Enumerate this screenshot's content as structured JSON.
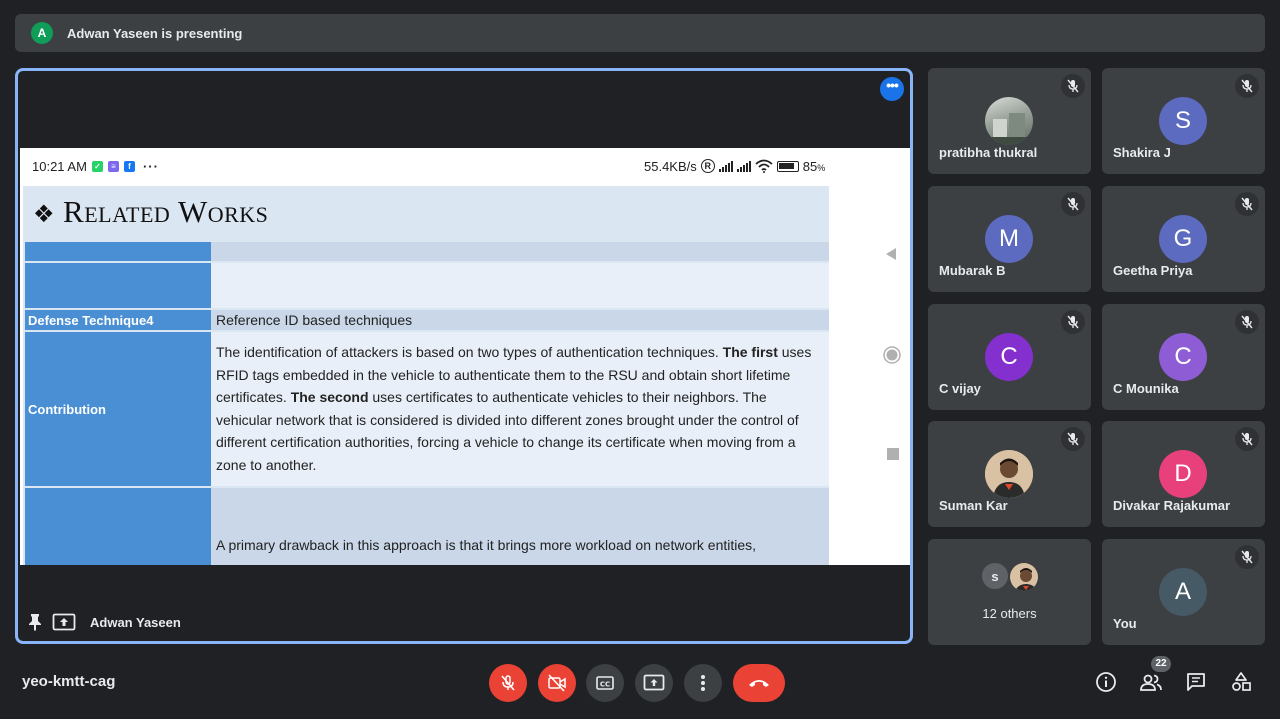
{
  "presenting": {
    "avatar_letter": "A",
    "text": "Adwan Yaseen is presenting",
    "avatar_color": "#0f9d58"
  },
  "main_tile": {
    "presenter_name": "Adwan Yaseen",
    "phone_status": {
      "time": "10:21 AM",
      "network_speed": "55.4KB/s",
      "battery": "85",
      "battery_unit": "%"
    },
    "slide": {
      "title": "Related Works",
      "rows": [
        {
          "label": "",
          "text": ""
        },
        {
          "label": "",
          "text": ""
        },
        {
          "label": "Defense Technique4",
          "text": "Reference ID based techniques"
        },
        {
          "label": "Contribution",
          "segments": [
            {
              "text": "The identification of attackers is based on two types of authentication techniques. ",
              "bold": false
            },
            {
              "text": "The first",
              "bold": true
            },
            {
              "text": " uses RFID tags embedded in the vehicle to authenticate them to the RSU and obtain short lifetime certificates. ",
              "bold": false
            },
            {
              "text": "The second",
              "bold": true
            },
            {
              "text": " uses certificates to authenticate vehicles to their neighbors. The vehicular network that is considered is divided into different zones brought under the control of different certification authorities, forcing a vehicle to change its certificate when moving from a zone to another.",
              "bold": false
            }
          ]
        },
        {
          "label": "",
          "text": "A primary drawback in this approach is that it brings more workload on network entities,"
        }
      ]
    }
  },
  "participants": [
    {
      "name": "pratibha thukral",
      "type": "photo",
      "muted": true
    },
    {
      "name": "Shakira J",
      "letter": "S",
      "color": "#5c6bc0",
      "muted": true
    },
    {
      "name": "Mubarak B",
      "letter": "M",
      "color": "#5c6bc0",
      "muted": true
    },
    {
      "name": "Geetha Priya",
      "letter": "G",
      "color": "#5c6bc0",
      "muted": true
    },
    {
      "name": "C vijay",
      "letter": "C",
      "color": "#8430ce",
      "muted": true
    },
    {
      "name": "C Mounika",
      "letter": "C",
      "color": "#8e5cd4",
      "muted": true
    },
    {
      "name": "Suman Kar",
      "type": "photo",
      "muted": true
    },
    {
      "name": "Divakar Rajakumar",
      "letter": "D",
      "color": "#e8407a",
      "muted": true
    },
    {
      "name": "12 others",
      "small_letter": "s",
      "type": "others"
    },
    {
      "name": "You",
      "letter": "A",
      "color": "#455a64",
      "muted": true
    }
  ],
  "bottom": {
    "meeting_code": "yeo-kmtt-cag",
    "people_count": "22"
  },
  "colors": {
    "accent": "#8ab4f8",
    "danger": "#ea4335",
    "surface": "#3c4043",
    "background": "#202124"
  }
}
